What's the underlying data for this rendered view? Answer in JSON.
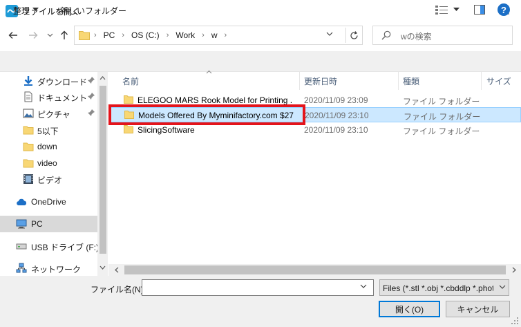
{
  "window": {
    "title": "ファイルを開く"
  },
  "address": {
    "crumbs": [
      "PC",
      "OS (C:)",
      "Work",
      "w"
    ],
    "search_placeholder": "wの検索"
  },
  "toolbar": {
    "organize": "整理",
    "new_folder": "新しいフォルダー"
  },
  "sidebar": {
    "items": [
      {
        "label": "ダウンロード",
        "icon": "download-icon",
        "pinned": true
      },
      {
        "label": "ドキュメント",
        "icon": "document-icon",
        "pinned": true
      },
      {
        "label": "ピクチャ",
        "icon": "picture-icon",
        "pinned": true
      },
      {
        "label": "5以下",
        "icon": "folder-icon"
      },
      {
        "label": "down",
        "icon": "folder-icon"
      },
      {
        "label": "video",
        "icon": "folder-icon"
      },
      {
        "label": "ビデオ",
        "icon": "video-icon"
      },
      {
        "label": "OneDrive",
        "icon": "cloud-icon"
      },
      {
        "label": "PC",
        "icon": "pc-icon",
        "selected": true
      },
      {
        "label": "USB ドライブ (F:)",
        "icon": "usb-drive-icon"
      },
      {
        "label": "ネットワーク",
        "icon": "network-icon"
      }
    ]
  },
  "columns": {
    "name": "名前",
    "date": "更新日時",
    "type": "種類",
    "size": "サイズ"
  },
  "files": [
    {
      "name": "ELEGOO MARS Rook Model for Printing ...",
      "date": "2020/11/09 23:09",
      "type": "ファイル フォルダー"
    },
    {
      "name": "Models Offered By Myminifactory.com $27",
      "date": "2020/11/09 23:10",
      "type": "ファイル フォルダー",
      "selected": true
    },
    {
      "name": "SlicingSoftware",
      "date": "2020/11/09 23:10",
      "type": "ファイル フォルダー"
    }
  ],
  "bottom": {
    "filename_label": "ファイル名(N):",
    "filename_value": "",
    "filter": "Files (*.stl *.obj *.cbddlp *.photon",
    "open": "開く(O)",
    "cancel": "キャンセル"
  },
  "colors": {
    "accent": "#0078d7",
    "selection": "#cce8ff",
    "highlight_box": "#e4141b"
  }
}
